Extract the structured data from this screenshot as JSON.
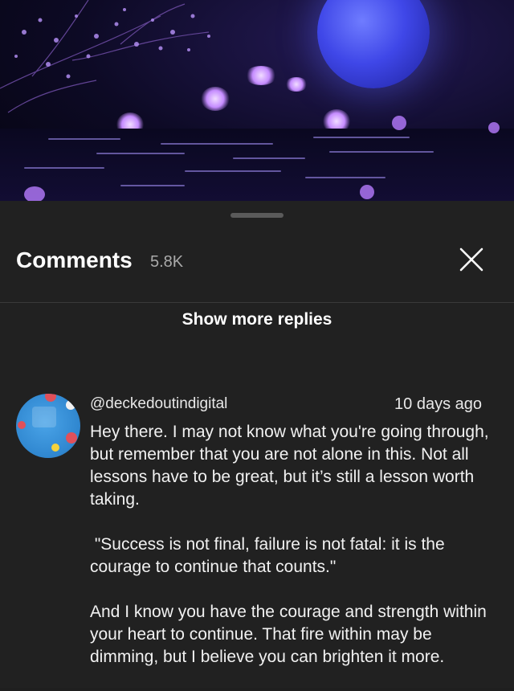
{
  "comments_panel": {
    "title": "Comments",
    "count": "5.8K"
  },
  "show_more_label": "Show more replies",
  "comment": {
    "author": "@deckedoutindigital",
    "time": "10 days ago",
    "paragraphs": [
      "Hey there. I may not know what you're going through, but remember that you are not alone in this. Not all lessons have to be great, but it’s still a lesson worth taking.",
      " \"Success is not final, failure is not fatal: it is the courage to continue that counts.\"",
      "And I know you have the courage and strength within your heart to continue. That fire within may be dimming, but I believe you can brighten it more."
    ]
  },
  "icons": {
    "close": "close-icon"
  },
  "colors": {
    "sheet_background": "#212121",
    "primary_text": "#f1f1f1",
    "secondary_text": "#aaaaaa",
    "moon": "#3f47e8"
  }
}
